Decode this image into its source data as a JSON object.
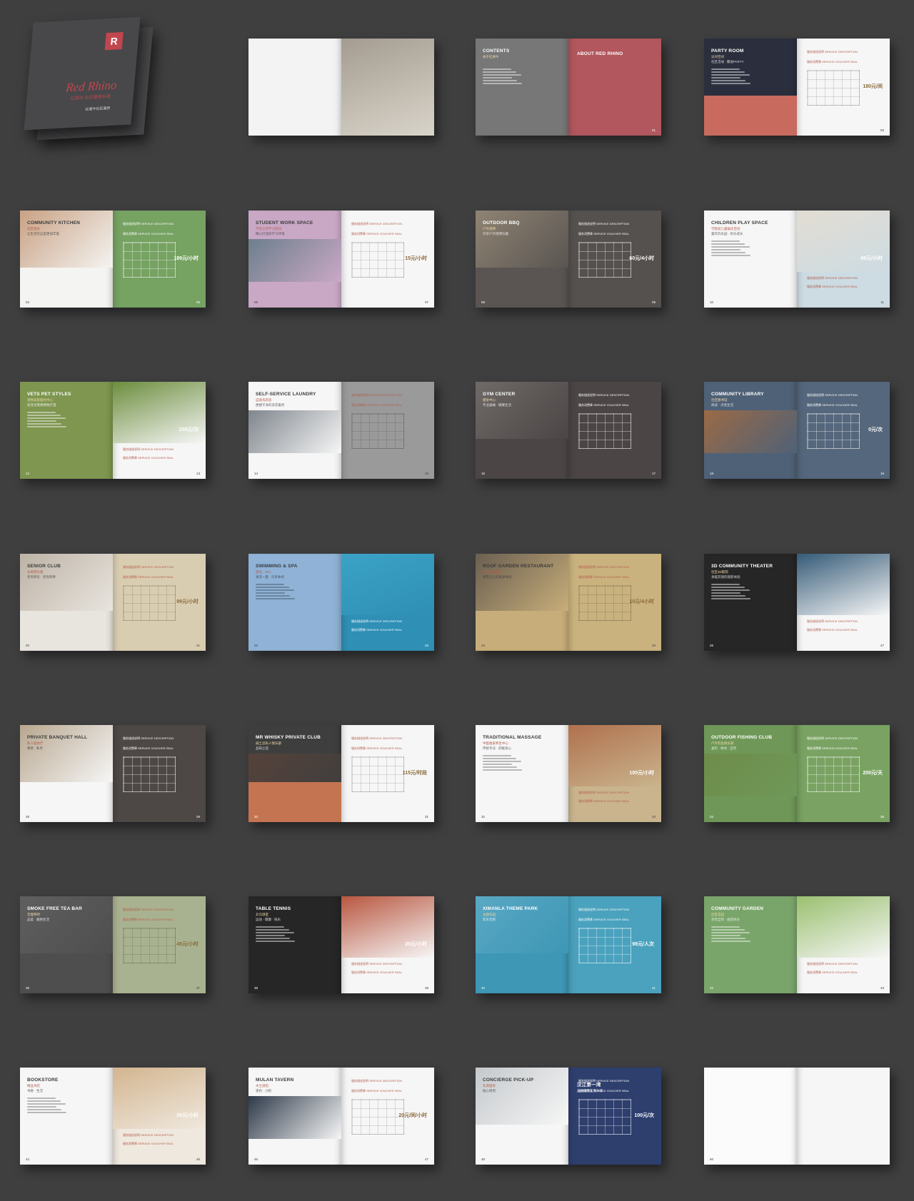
{
  "cover": {
    "logo": "R",
    "title": "Red Rhino",
    "subtitle": "红犀牛 社区服务手册",
    "footer": "红犀牛社区服务"
  },
  "spreads": [
    {
      "leftBg": "#f3f3f3",
      "rightBg": "#d9d4ca",
      "rightPhoto": "#a49c90",
      "title": "",
      "sub": "",
      "price": "",
      "pl": "",
      "pr": ""
    },
    {
      "leftBg": "#777777",
      "rightBg": "#b1575d",
      "title": "CONTENTS",
      "title2": "ABOUT RED RHINO",
      "sub": "关于红犀牛",
      "price": "",
      "pl": "",
      "pr": "01"
    },
    {
      "leftBg": "#2b2f3d",
      "rightBg": "#f6f6f6",
      "lowerBg": "#c86a5e",
      "title": "PARTY ROOM",
      "sub": "派对空间",
      "sub2": "社区活动 · 聚会PARTY",
      "price": "180元/间",
      "label": "服务描述说明 SERVICE DESCRIPTION",
      "label2": "服务消费章 SERVICE VOUCHER SEAL",
      "pl": "",
      "pr": "03"
    },
    {
      "leftBg": "#f4f4f2",
      "rightBg": "#76a262",
      "leftPhoto": "#c9a183",
      "title": "COMMUNITY KITCHEN",
      "sub": "社区厨房",
      "sub2": "让生活在这里更加丰富",
      "price": "189元/小时",
      "label": "服务描述说明 SERVICE DESCRIPTION",
      "label2": "服务消费章 SERVICE VOUCHER SEAL",
      "pl": "04",
      "pr": "05"
    },
    {
      "leftBg": "#c9a8c6",
      "rightBg": "#f6f6f6",
      "leftPhoto": "#6d7f8c",
      "title": "STUDENT WORK SPACE",
      "sub": "学生工作学习空间",
      "sub2": "精心打造的学习环境",
      "price": "15元/小时",
      "label": "服务描述说明 SERVICE DESCRIPTION",
      "label2": "服务消费章 SERVICE VOUCHER SEAL",
      "pl": "06",
      "pr": "07"
    },
    {
      "leftBg": "#5a5552",
      "rightBg": "#55514e",
      "leftPhoto": "#8f8473",
      "title": "OUTDOOR BBQ",
      "sub": "户外烧烤",
      "sub2": "尽享户外烧烤乐趣",
      "price": "60元/4小时",
      "label": "服务描述说明 SERVICE DESCRIPTION",
      "label2": "服务消费章 SERVICE VOUCHER SEAL",
      "pl": "08",
      "pr": "09"
    },
    {
      "leftBg": "#f6f6f6",
      "rightBg": "#cddbe2",
      "rightPhoto": "#e3ddd3",
      "title": "CHILDREN PLAY SPACE",
      "sub": "学龄前儿童娱乐空间",
      "sub2": "童年的乐园 · 欢乐成长",
      "price": "99元/小时",
      "label": "服务描述说明 SERVICE DESCRIPTION",
      "label2": "服务消费章 SERVICE VOUCHER SEAL",
      "pl": "10",
      "pr": "11"
    },
    {
      "leftBg": "#7e9650",
      "rightBg": "#f6f6f6",
      "rightPhoto": "#6c8d3d",
      "title": "VETS PET STYLES",
      "sub": "宠物美容服务中心",
      "sub2": "爱宠也需要精致打理",
      "price": "238元/次",
      "label": "服务描述说明 SERVICE DESCRIPTION",
      "label2": "服务消费章 SERVICE VOUCHER SEAL",
      "pl": "12",
      "pr": "13"
    },
    {
      "leftBg": "#f6f6f6",
      "rightBg": "#9a9a9a",
      "leftPhoto": "#7f868d",
      "title": "SELF-SERVICE LAUNDRY",
      "sub": "自助洗衣房",
      "sub2": "便捷干净的洗衣服务",
      "price": "",
      "label": "服务描述说明 SERVICE DESCRIPTION",
      "label2": "服务消费章 SERVICE VOUCHER SEAL",
      "pl": "14",
      "pr": "15"
    },
    {
      "leftBg": "#4b4645",
      "rightBg": "#4b4645",
      "leftPhoto": "#6f6a68",
      "title": "GYM CENTER",
      "sub": "健身中心",
      "sub2": "专业器械 · 健康生活",
      "price": "",
      "label": "服务描述说明 SERVICE DESCRIPTION",
      "label2": "服务消费章 SERVICE VOUCHER SEAL",
      "pl": "16",
      "pr": "17"
    },
    {
      "leftBg": "#4f6177",
      "rightBg": "#55677c",
      "leftPhoto": "#9b6a45",
      "title": "COMMUNITY LIBRARY",
      "sub": "社区图书馆",
      "sub2": "阅读 · 点亮生活",
      "price": "0元/次",
      "label": "服务描述说明 SERVICE DESCRIPTION",
      "label2": "服务消费章 SERVICE VOUCHER SEAL",
      "pl": "18",
      "pr": "19"
    },
    {
      "leftBg": "#e8e4de",
      "rightBg": "#d9cdb1",
      "leftPhoto": "#bdb3a6",
      "title": "SENIOR CLUB",
      "sub": "长者俱乐部",
      "sub2": "老有所乐 · 老有所养",
      "price": "99元/小时",
      "label": "服务描述说明 SERVICE DESCRIPTION",
      "label2": "服务消费章 SERVICE VOUCHER SEAL",
      "pl": "20",
      "pr": "21"
    },
    {
      "leftBg": "#8fb2d6",
      "rightBg": "#2f8fb5",
      "rightPhoto": "#3ba2c6",
      "title": "SWIMMING & SPA",
      "sub": "游泳 · SPA",
      "sub2": "清凉一夏 · 尽享休闲",
      "price": "",
      "label": "服务描述说明 SERVICE DESCRIPTION",
      "label2": "服务消费章 SERVICE VOUCHER SEAL",
      "pl": "22",
      "pr": "23"
    },
    {
      "leftBg": "#c7ad79",
      "rightBg": "#c9b27e",
      "leftPhoto": "#6a5f51",
      "title": "ROOF GARDEN RESTAURANT",
      "sub": "空中花园餐厅",
      "sub2": "城市之上的美食体验",
      "price": "10元/4小时",
      "label": "服务描述说明 SERVICE DESCRIPTION",
      "label2": "服务消费章 SERVICE VOUCHER SEAL",
      "pl": "24",
      "pr": "25"
    },
    {
      "leftBg": "#262626",
      "rightBg": "#f6f6f6",
      "rightPhoto": "#355b78",
      "title": "3D COMMUNITY THEATER",
      "sub": "社区3D影院",
      "sub2": "身临其境的观影体验",
      "price": "",
      "label": "服务描述说明 SERVICE DESCRIPTION",
      "label2": "服务消费章 SERVICE VOUCHER SEAL",
      "pl": "26",
      "pr": "27"
    },
    {
      "leftBg": "#f6f6f6",
      "rightBg": "#4d4845",
      "leftPhoto": "#b8a78f",
      "title": "PRIVATE BANQUET HALL",
      "sub": "私人宴会厅",
      "sub2": "尊贵 · 私享",
      "price": "",
      "label": "服务描述说明 SERVICE DESCRIPTION",
      "label2": "服务消费章 SERVICE VOUCHER SEAL",
      "pl": "28",
      "pr": "29"
    },
    {
      "leftBg": "#3e3e3e",
      "rightBg": "#f6f6f6",
      "lowerBg": "#c57451",
      "leftPhoto": "#56423a",
      "title": "MR WHISKY PRIVATE CLUB",
      "sub": "威士忌私人俱乐部",
      "sub2": "品味之选",
      "price": "115元/时段",
      "label": "服务描述说明 SERVICE DESCRIPTION",
      "label2": "服务消费章 SERVICE VOUCHER SEAL",
      "pl": "30",
      "pr": "31"
    },
    {
      "leftBg": "#f6f6f6",
      "rightBg": "#c9b48d",
      "rightPhoto": "#b0714e",
      "title": "TRADITIONAL MASSAGE",
      "sub": "中医推拿养生中心",
      "sub2": "传统手法 · 舒缓身心",
      "price": "100元/小时",
      "label": "服务描述说明 SERVICE DESCRIPTION",
      "label2": "服务消费章 SERVICE VOUCHER SEAL",
      "pl": "32",
      "pr": "33"
    },
    {
      "leftBg": "#6f9858",
      "rightBg": "#7aa363",
      "leftPhoto": "#6e8c4a",
      "title": "OUTDOOR FISHING CLUB",
      "sub": "户外钓鱼俱乐部",
      "sub2": "垂钓 · 休闲 · 自然",
      "price": "200元/天",
      "label": "服务描述说明 SERVICE DESCRIPTION",
      "label2": "服务消费章 SERVICE VOUCHER SEAL",
      "pl": "34",
      "pr": "35"
    },
    {
      "leftBg": "#4e4e4e",
      "rightBg": "#a9b290",
      "leftPhoto": "#5f5f5f",
      "title": "SMOKE FREE TEA BAR",
      "sub": "无烟茶吧",
      "sub2": "品茗 · 雅致生活",
      "price": "45元/小时",
      "label": "服务描述说明 SERVICE DESCRIPTION",
      "label2": "服务消费章 SERVICE VOUCHER SEAL",
      "pl": "36",
      "pr": "37"
    },
    {
      "leftBg": "#262626",
      "rightBg": "#f6f6f6",
      "rightPhoto": "#b8563f",
      "title": "TABLE TENNIS",
      "sub": "乒乓球室",
      "sub2": "运动 · 健康 · 快乐",
      "price": "20元/小时",
      "label": "服务描述说明 SERVICE DESCRIPTION",
      "label2": "服务消费章 SERVICE VOUCHER SEAL",
      "pl": "38",
      "pr": "39"
    },
    {
      "leftBg": "#3d97b5",
      "rightBg": "#4aa2be",
      "leftPhoto": "#5aa8c4",
      "title": "XIMANLA THEME PARK",
      "sub": "主题乐园",
      "sub2": "欢乐无限",
      "price": "98元/人次",
      "label": "服务描述说明 SERVICE DESCRIPTION",
      "label2": "服务消费章 SERVICE VOUCHER SEAL",
      "pl": "40",
      "pr": "41"
    },
    {
      "leftBg": "#7aa56a",
      "rightBg": "#f6f6f6",
      "rightPhoto": "#9ac06f",
      "title": "COMMUNITY GARDEN",
      "sub": "社区菜园",
      "sub2": "亲近自然 · 收获快乐",
      "price": "",
      "label": "服务描述说明 SERVICE DESCRIPTION",
      "label2": "服务消费章 SERVICE VOUCHER SEAL",
      "pl": "42",
      "pr": "43"
    },
    {
      "leftBg": "#f6f6f6",
      "rightBg": "#efe8de",
      "rightPhoto": "#d3b58f",
      "title": "BOOKSTORE",
      "sub": "精品书店",
      "sub2": "书香 · 生活",
      "price": "20元/小时",
      "label": "服务描述说明 SERVICE DESCRIPTION",
      "label2": "服务消费章 SERVICE VOUCHER SEAL",
      "pl": "44",
      "pr": "45"
    },
    {
      "leftBg": "#f6f6f6",
      "rightBg": "#f6f6f6",
      "leftPhoto": "#2e3a4a",
      "title": "MULAN TAVERN",
      "sub": "木兰酒馆",
      "sub2": "夜色 · 小酌",
      "price": "20元/间/小时",
      "label": "服务描述说明 SERVICE DESCRIPTION",
      "label2": "服务消费章 SERVICE VOUCHER SEAL",
      "pl": "46",
      "pr": "47"
    },
    {
      "leftBg": "#f6f6f6",
      "rightBg": "#2e3f6e",
      "leftPhoto": "#c5c9cc",
      "title": "CONCIERGE PICK-UP",
      "sub": "礼宾服务",
      "sub2": "贴心周到",
      "price": "100元/次",
      "title2": "汉江第一湾",
      "sub3": "品质精装江景头排",
      "label": "服务描述说明 SERVICE DESCRIPTION",
      "label2": "服务消费章 SERVICE VOUCHER SEAL",
      "pl": "48",
      "pr": ""
    },
    {
      "leftBg": "#fbfbfb",
      "rightBg": "#f6f6f6",
      "title": "",
      "sub": "",
      "price": "",
      "pl": "50",
      "pr": ""
    }
  ]
}
